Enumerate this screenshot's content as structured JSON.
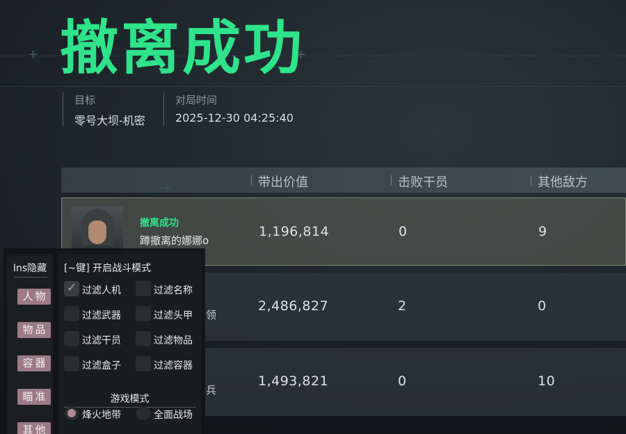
{
  "result_title": "撤离成功",
  "meta": {
    "target_label": "目标",
    "target_value": "零号大坝-机密",
    "time_label": "对局时间",
    "time_value": "2025-12-30 04:25:40"
  },
  "table": {
    "headers": [
      "带出价值",
      "击败干员",
      "其他敌方"
    ],
    "rows": [
      {
        "status": "撤离成功",
        "name": "蹲撤离的娜娜o",
        "value": "1,196,814",
        "kills": "0",
        "others": "9"
      },
      {
        "partial_name": "领",
        "value": "2,486,827",
        "kills": "2",
        "others": "0"
      },
      {
        "partial_name": "兵",
        "value": "1,493,821",
        "kills": "0",
        "others": "10"
      }
    ]
  },
  "overlay": {
    "ins_label": "Ins隐藏",
    "side_buttons": [
      "人物",
      "物品",
      "容器",
      "瞄准",
      "其他"
    ],
    "hint": "[~键] 开启战斗模式",
    "filters": [
      {
        "label": "过滤人机",
        "checked": true
      },
      {
        "label": "过滤名称",
        "checked": false
      },
      {
        "label": "过滤武器",
        "checked": false
      },
      {
        "label": "过滤头甲",
        "checked": false
      },
      {
        "label": "过滤干员",
        "checked": false
      },
      {
        "label": "过滤物品",
        "checked": false
      },
      {
        "label": "过滤盒子",
        "checked": false
      },
      {
        "label": "过滤容器",
        "checked": false
      }
    ],
    "mode_title": "游戏模式",
    "modes": [
      {
        "label": "烽火地带",
        "selected": true
      },
      {
        "label": "全面战场",
        "selected": false
      }
    ]
  },
  "colors": {
    "accent_green": "#2ee38a",
    "menu_button": "#9b7b86",
    "check_tick": "#b59aa3"
  },
  "icons": [
    "crosshair-icon",
    "checkmark-icon",
    "radio-dot-icon",
    "avatar-portrait"
  ]
}
